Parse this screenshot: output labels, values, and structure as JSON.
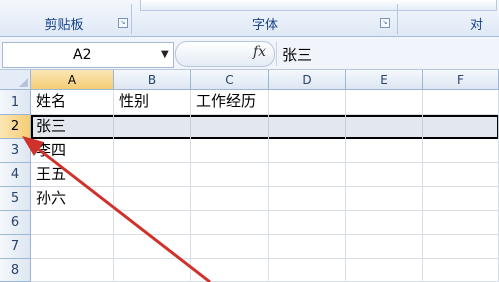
{
  "ribbon": {
    "groups": [
      {
        "label": "剪贴板"
      },
      {
        "label": "字体"
      },
      {
        "label": "对"
      }
    ]
  },
  "formula_bar": {
    "name_box": "A2",
    "fx_label": "fx",
    "content": "张三"
  },
  "grid": {
    "columns": [
      "A",
      "B",
      "C",
      "D",
      "E",
      "F"
    ],
    "rows": [
      "1",
      "2",
      "3",
      "4",
      "5",
      "6",
      "7",
      "8"
    ],
    "cells": {
      "A1": "姓名",
      "B1": "性别",
      "C1": "工作经历",
      "A2": "张三",
      "A3": "李四",
      "A4": "王五",
      "A5": "孙六"
    },
    "selected_row": "2",
    "selected_column": "A"
  },
  "annotation": {
    "arrow_color": "#d0312a"
  }
}
